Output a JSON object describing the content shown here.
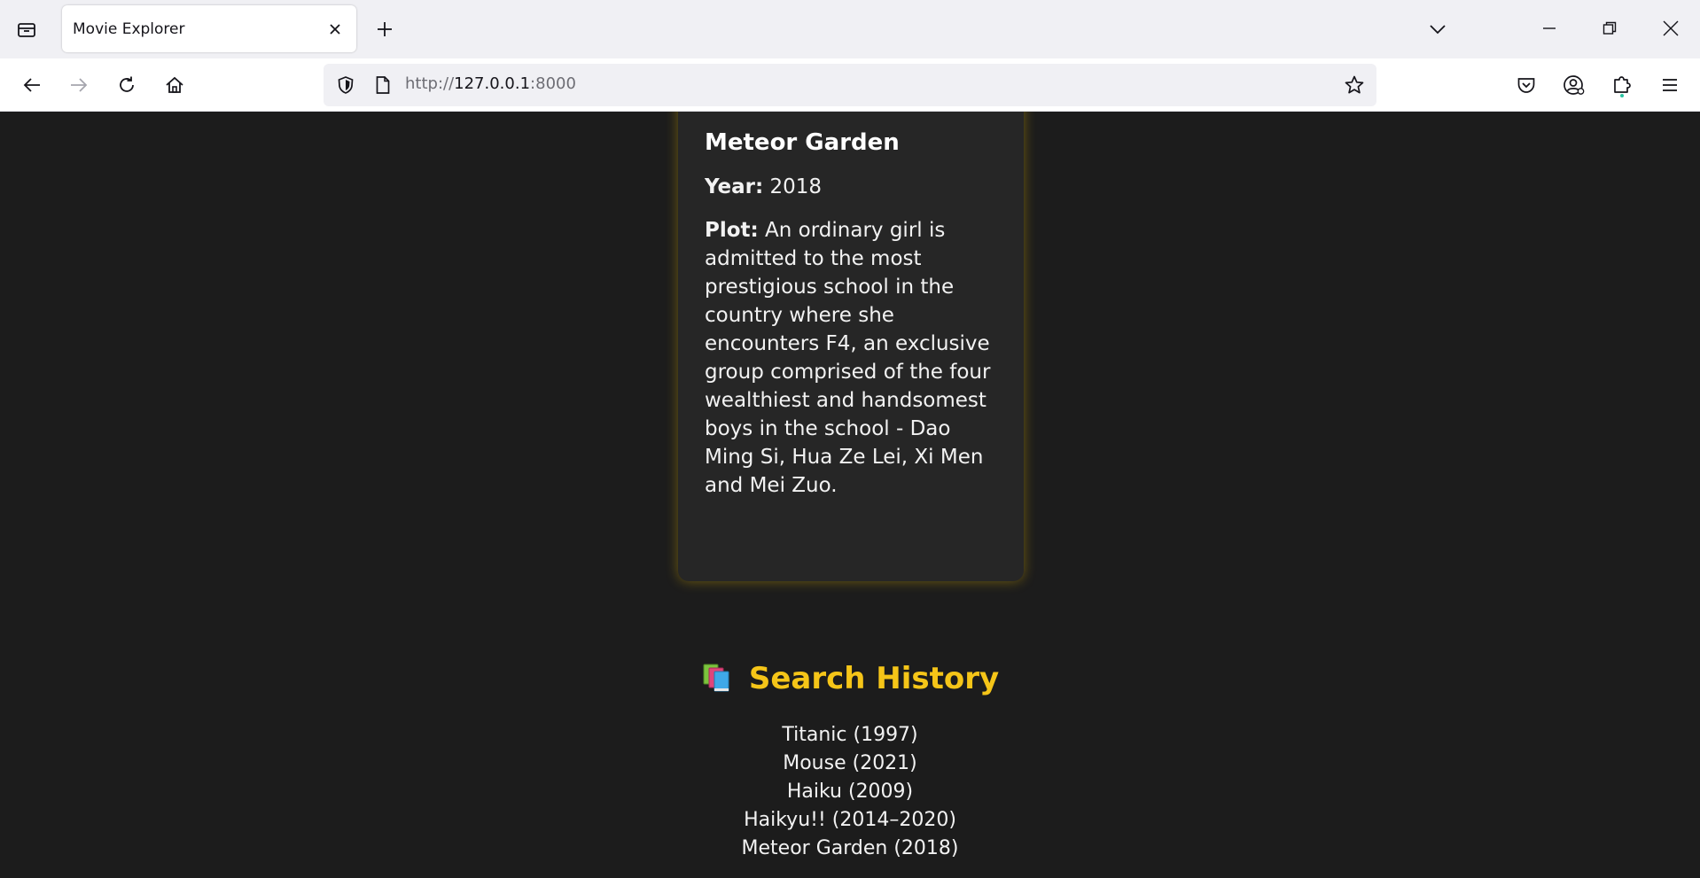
{
  "browser": {
    "tab_title": "Movie Explorer",
    "url_host": "http://127.0.0.1",
    "url_port": ":8000",
    "url_scheme_display": "http://",
    "url_host_display": "127.0.0.1",
    "icons": [
      "tab-list-icon",
      "close-icon",
      "plus-icon",
      "chevron-down-icon",
      "minimize-icon",
      "restore-icon",
      "close-window-icon",
      "back-arrow-icon",
      "forward-arrow-icon",
      "reload-icon",
      "home-icon",
      "shield-icon",
      "page-icon",
      "star-icon",
      "pocket-icon",
      "account-icon",
      "extensions-icon",
      "menu-icon"
    ]
  },
  "movie": {
    "title": "Meteor Garden",
    "year_label": "Year:",
    "year": "2018",
    "plot_label": "Plot:",
    "plot": "An ordinary girl is admitted to the most prestigious school in the country where she encounters F4, an exclusive group comprised of the four wealthiest and handsomest boys in the school - Dao Ming Si, Hua Ze Lei, Xi Men and Mei Zuo."
  },
  "history": {
    "heading": "Search History",
    "icon": "books-icon",
    "items": [
      "Titanic (1997)",
      "Mouse (2021)",
      "Haiku (2009)",
      "Haikyu!! (2014–2020)",
      "Meteor Garden (2018)"
    ]
  },
  "colors": {
    "page_bg": "#1c1c1c",
    "card_bg": "#262626",
    "accent": "#f5c518",
    "text": "#f2f2f2"
  }
}
